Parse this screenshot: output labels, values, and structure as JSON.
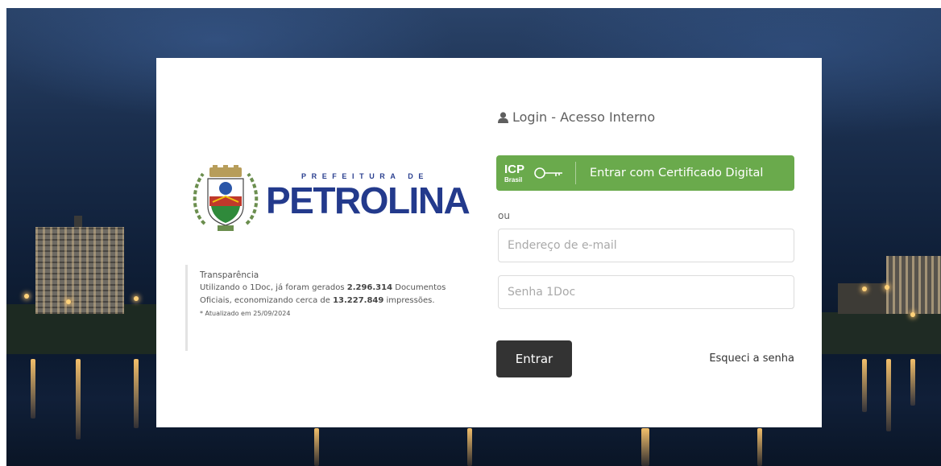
{
  "brand": {
    "line1": "PREFEITURA DE",
    "line2": "PETROLINA"
  },
  "transparency": {
    "title": "Transparência",
    "line1_prefix": "Utilizando o 1Doc, já foram gerados ",
    "documents_count": "2.296.314",
    "line1_suffix": " Documentos",
    "line2_prefix": "Oficiais, economizando cerca de ",
    "prints_count": "13.227.849",
    "line2_suffix": " impressões.",
    "note": "* Atualizado em 25/09/2024"
  },
  "login": {
    "heading": "Login - Acesso Interno",
    "heading_icon": "user-icon",
    "certificate_button": "Entrar com Certificado Digital",
    "certificate_logo_main": "ICP",
    "certificate_logo_sub": "Brasil",
    "or_label": "ou",
    "email_placeholder": "Endereço de e-mail",
    "password_placeholder": "Senha 1Doc",
    "submit_label": "Entrar",
    "forgot_label": "Esqueci a senha"
  },
  "colors": {
    "certificate_green": "#6aaa4c",
    "submit_dark": "#333333",
    "brand_blue": "#233a8c"
  }
}
